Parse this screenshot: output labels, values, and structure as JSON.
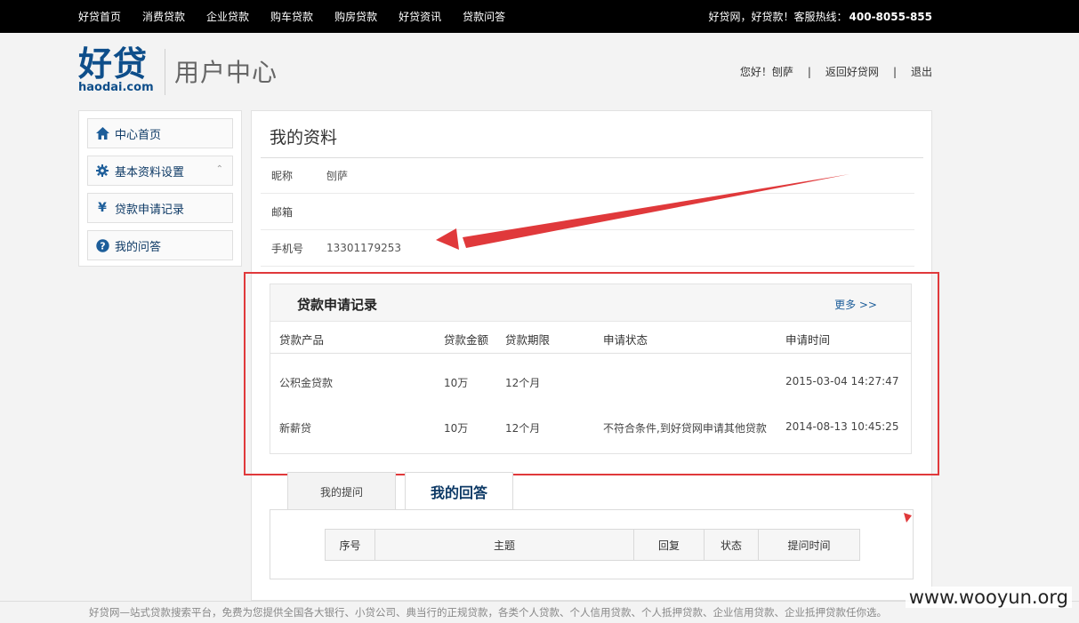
{
  "topnav": {
    "items": [
      "好贷首页",
      "消费贷款",
      "企业贷款",
      "购车贷款",
      "购房贷款",
      "好贷资讯",
      "贷款问答"
    ],
    "slogan": "好贷网，好贷款！客服热线：",
    "hotline": "400-8055-855"
  },
  "header": {
    "logo_cn": "好贷",
    "logo_en": "haodai.com",
    "center_title": "用户中心",
    "greeting": "您好！刨萨",
    "return_link": "返回好贷网",
    "logout": "退出",
    "separator": "|"
  },
  "sidebar": {
    "items": [
      {
        "label": "中心首页",
        "icon": "home-icon"
      },
      {
        "label": "基本资料设置",
        "icon": "gear-icon"
      },
      {
        "label": "贷款申请记录",
        "icon": "yen-icon"
      },
      {
        "label": "我的问答",
        "icon": "question-icon"
      }
    ],
    "chevron": "⌃"
  },
  "profile": {
    "title": "我的资料",
    "rows": [
      {
        "label": "昵称",
        "value": "刨萨"
      },
      {
        "label": "邮箱",
        "value": ""
      },
      {
        "label": "手机号",
        "value": "13301179253"
      }
    ]
  },
  "loans": {
    "title": "贷款申请记录",
    "more": "更多 >>",
    "columns": [
      "贷款产品",
      "贷款金额",
      "贷款期限",
      "申请状态",
      "申请时间"
    ],
    "rows": [
      [
        "公积金贷款",
        "10万",
        "12个月",
        "",
        "2015-03-04 14:27:47"
      ],
      [
        "新薪贷",
        "10万",
        "12个月",
        "不符合条件,到好贷网申请其他贷款",
        "2014-08-13 10:45:25"
      ]
    ]
  },
  "qa": {
    "tabs": [
      "我的提问",
      "我的回答"
    ],
    "columns": [
      "序号",
      "主题",
      "回复",
      "状态",
      "提问时间"
    ]
  },
  "footer": {
    "text": "好贷网—站式贷款搜索平台，免费为您提供全国各大银行、小贷公司、典当行的正规贷款，各类个人贷款、个人信用贷款、个人抵押贷款、企业信用贷款、企业抵押贷款任你选。",
    "watermark": "www.wooyun.org"
  },
  "colors": {
    "brand": "#0e4e8a",
    "annotation": "#e0393b",
    "link": "#1d5e9a"
  }
}
